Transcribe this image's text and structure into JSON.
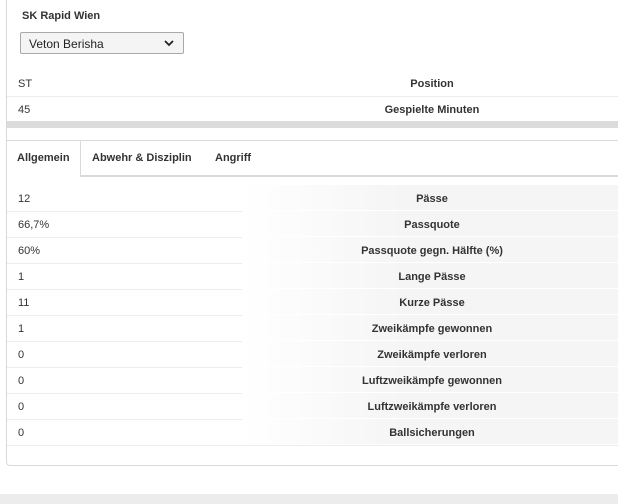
{
  "team": "SK Rapid Wien",
  "player_select": {
    "selected": "Veton Berisha"
  },
  "info_rows": [
    {
      "value": "ST",
      "label": "Position"
    },
    {
      "value": "45",
      "label": "Gespielte Minuten"
    }
  ],
  "tabs": [
    {
      "label": "Allgemein",
      "active": true
    },
    {
      "label": "Abwehr & Disziplin",
      "active": false
    },
    {
      "label": "Angriff",
      "active": false
    }
  ],
  "stats": [
    {
      "value": "12",
      "label": "Pässe"
    },
    {
      "value": "66,7%",
      "label": "Passquote"
    },
    {
      "value": "60%",
      "label": "Passquote gegn. Hälfte (%)"
    },
    {
      "value": "1",
      "label": "Lange Pässe"
    },
    {
      "value": "11",
      "label": "Kurze Pässe"
    },
    {
      "value": "1",
      "label": "Zweikämpfe gewonnen"
    },
    {
      "value": "0",
      "label": "Zweikämpfe verloren"
    },
    {
      "value": "0",
      "label": "Luftzweikämpfe gewonnen"
    },
    {
      "value": "0",
      "label": "Luftzweikämpfe verloren"
    },
    {
      "value": "0",
      "label": "Ballsicherungen"
    }
  ]
}
